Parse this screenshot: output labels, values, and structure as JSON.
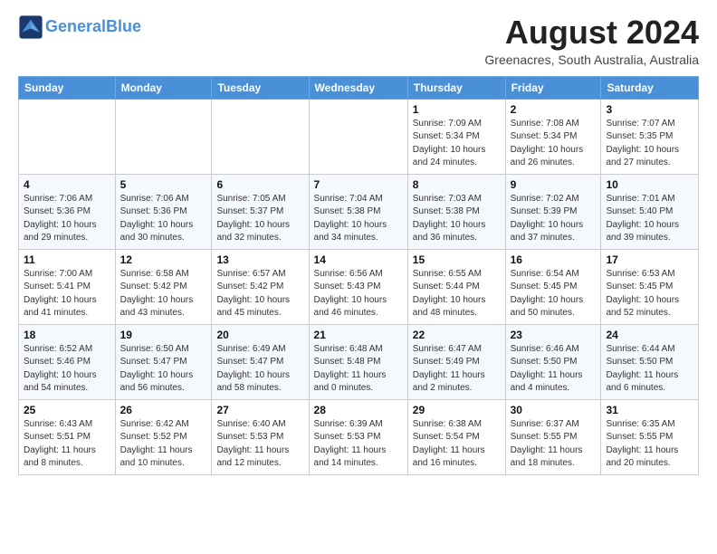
{
  "header": {
    "logo_line1": "General",
    "logo_line2": "Blue",
    "month_title": "August 2024",
    "subtitle": "Greenacres, South Australia, Australia"
  },
  "weekdays": [
    "Sunday",
    "Monday",
    "Tuesday",
    "Wednesday",
    "Thursday",
    "Friday",
    "Saturday"
  ],
  "weeks": [
    [
      {
        "day": "",
        "info": ""
      },
      {
        "day": "",
        "info": ""
      },
      {
        "day": "",
        "info": ""
      },
      {
        "day": "",
        "info": ""
      },
      {
        "day": "1",
        "info": "Sunrise: 7:09 AM\nSunset: 5:34 PM\nDaylight: 10 hours\nand 24 minutes."
      },
      {
        "day": "2",
        "info": "Sunrise: 7:08 AM\nSunset: 5:34 PM\nDaylight: 10 hours\nand 26 minutes."
      },
      {
        "day": "3",
        "info": "Sunrise: 7:07 AM\nSunset: 5:35 PM\nDaylight: 10 hours\nand 27 minutes."
      }
    ],
    [
      {
        "day": "4",
        "info": "Sunrise: 7:06 AM\nSunset: 5:36 PM\nDaylight: 10 hours\nand 29 minutes."
      },
      {
        "day": "5",
        "info": "Sunrise: 7:06 AM\nSunset: 5:36 PM\nDaylight: 10 hours\nand 30 minutes."
      },
      {
        "day": "6",
        "info": "Sunrise: 7:05 AM\nSunset: 5:37 PM\nDaylight: 10 hours\nand 32 minutes."
      },
      {
        "day": "7",
        "info": "Sunrise: 7:04 AM\nSunset: 5:38 PM\nDaylight: 10 hours\nand 34 minutes."
      },
      {
        "day": "8",
        "info": "Sunrise: 7:03 AM\nSunset: 5:38 PM\nDaylight: 10 hours\nand 36 minutes."
      },
      {
        "day": "9",
        "info": "Sunrise: 7:02 AM\nSunset: 5:39 PM\nDaylight: 10 hours\nand 37 minutes."
      },
      {
        "day": "10",
        "info": "Sunrise: 7:01 AM\nSunset: 5:40 PM\nDaylight: 10 hours\nand 39 minutes."
      }
    ],
    [
      {
        "day": "11",
        "info": "Sunrise: 7:00 AM\nSunset: 5:41 PM\nDaylight: 10 hours\nand 41 minutes."
      },
      {
        "day": "12",
        "info": "Sunrise: 6:58 AM\nSunset: 5:42 PM\nDaylight: 10 hours\nand 43 minutes."
      },
      {
        "day": "13",
        "info": "Sunrise: 6:57 AM\nSunset: 5:42 PM\nDaylight: 10 hours\nand 45 minutes."
      },
      {
        "day": "14",
        "info": "Sunrise: 6:56 AM\nSunset: 5:43 PM\nDaylight: 10 hours\nand 46 minutes."
      },
      {
        "day": "15",
        "info": "Sunrise: 6:55 AM\nSunset: 5:44 PM\nDaylight: 10 hours\nand 48 minutes."
      },
      {
        "day": "16",
        "info": "Sunrise: 6:54 AM\nSunset: 5:45 PM\nDaylight: 10 hours\nand 50 minutes."
      },
      {
        "day": "17",
        "info": "Sunrise: 6:53 AM\nSunset: 5:45 PM\nDaylight: 10 hours\nand 52 minutes."
      }
    ],
    [
      {
        "day": "18",
        "info": "Sunrise: 6:52 AM\nSunset: 5:46 PM\nDaylight: 10 hours\nand 54 minutes."
      },
      {
        "day": "19",
        "info": "Sunrise: 6:50 AM\nSunset: 5:47 PM\nDaylight: 10 hours\nand 56 minutes."
      },
      {
        "day": "20",
        "info": "Sunrise: 6:49 AM\nSunset: 5:47 PM\nDaylight: 10 hours\nand 58 minutes."
      },
      {
        "day": "21",
        "info": "Sunrise: 6:48 AM\nSunset: 5:48 PM\nDaylight: 11 hours\nand 0 minutes."
      },
      {
        "day": "22",
        "info": "Sunrise: 6:47 AM\nSunset: 5:49 PM\nDaylight: 11 hours\nand 2 minutes."
      },
      {
        "day": "23",
        "info": "Sunrise: 6:46 AM\nSunset: 5:50 PM\nDaylight: 11 hours\nand 4 minutes."
      },
      {
        "day": "24",
        "info": "Sunrise: 6:44 AM\nSunset: 5:50 PM\nDaylight: 11 hours\nand 6 minutes."
      }
    ],
    [
      {
        "day": "25",
        "info": "Sunrise: 6:43 AM\nSunset: 5:51 PM\nDaylight: 11 hours\nand 8 minutes."
      },
      {
        "day": "26",
        "info": "Sunrise: 6:42 AM\nSunset: 5:52 PM\nDaylight: 11 hours\nand 10 minutes."
      },
      {
        "day": "27",
        "info": "Sunrise: 6:40 AM\nSunset: 5:53 PM\nDaylight: 11 hours\nand 12 minutes."
      },
      {
        "day": "28",
        "info": "Sunrise: 6:39 AM\nSunset: 5:53 PM\nDaylight: 11 hours\nand 14 minutes."
      },
      {
        "day": "29",
        "info": "Sunrise: 6:38 AM\nSunset: 5:54 PM\nDaylight: 11 hours\nand 16 minutes."
      },
      {
        "day": "30",
        "info": "Sunrise: 6:37 AM\nSunset: 5:55 PM\nDaylight: 11 hours\nand 18 minutes."
      },
      {
        "day": "31",
        "info": "Sunrise: 6:35 AM\nSunset: 5:55 PM\nDaylight: 11 hours\nand 20 minutes."
      }
    ]
  ]
}
